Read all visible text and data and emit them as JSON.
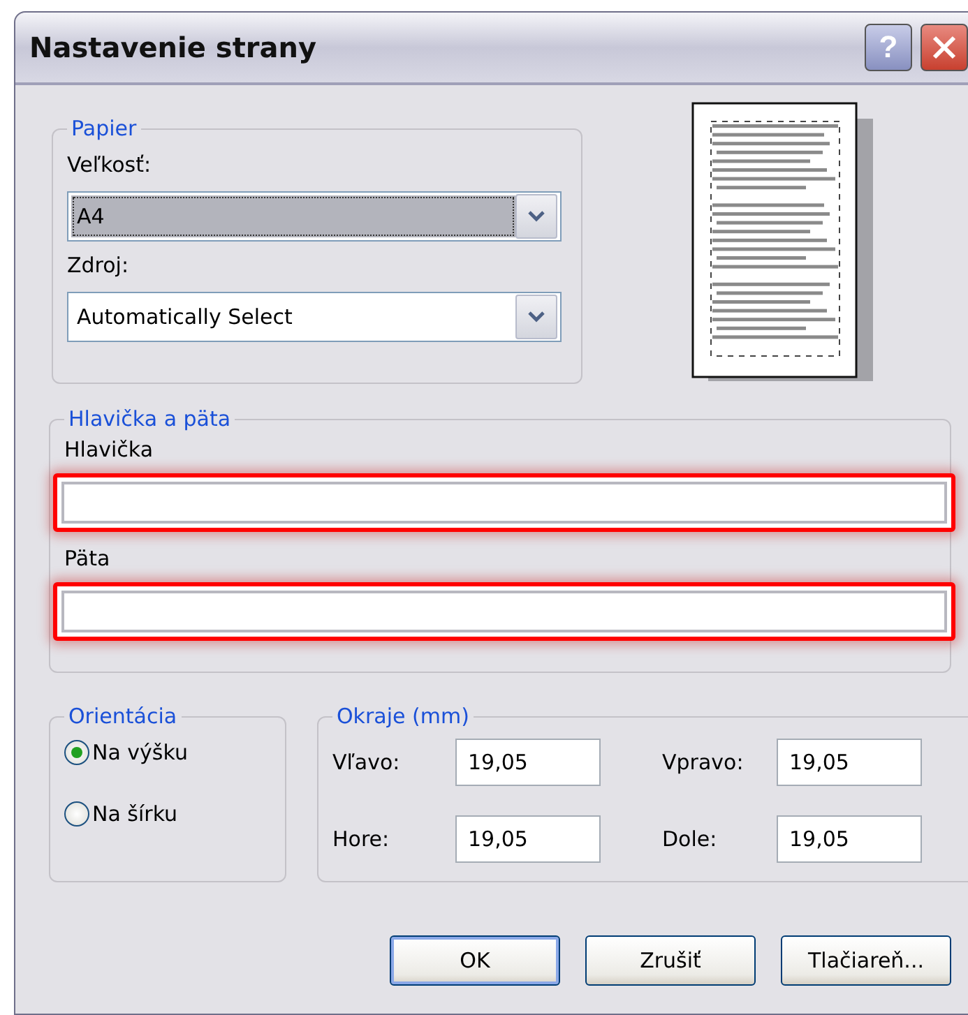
{
  "window": {
    "title": "Nastavenie strany",
    "help_button": "?"
  },
  "paper": {
    "legend": "Papier",
    "selects": [
      {
        "label": "Veľkosť:",
        "value": "A4",
        "focused": true
      },
      {
        "label": "Zdroj:",
        "value": "Automatically Select",
        "focused": false
      }
    ]
  },
  "header_footer": {
    "legend": "Hlavička a päta",
    "fields": [
      {
        "label": "Hlavička",
        "highlighted": true
      },
      {
        "label": "Päta",
        "highlighted": true
      }
    ]
  },
  "orientation": {
    "legend": "Orientácia",
    "options": [
      {
        "label": "Na výšku",
        "selected": true
      },
      {
        "label": "Na šírku",
        "selected": false
      }
    ]
  },
  "margins": {
    "legend": "Okraje (mm)",
    "fields": [
      {
        "label": "Vľavo:",
        "value": "19,05"
      },
      {
        "label": "Vpravo:",
        "value": "19,05"
      },
      {
        "label": "Hore:",
        "value": "19,05"
      },
      {
        "label": "Dole:",
        "value": "19,05"
      }
    ]
  },
  "buttons": [
    {
      "label": "OK",
      "default": true
    },
    {
      "label": "Zrušiť",
      "default": false
    },
    {
      "label": "Tlačiareň...",
      "default": false
    }
  ]
}
